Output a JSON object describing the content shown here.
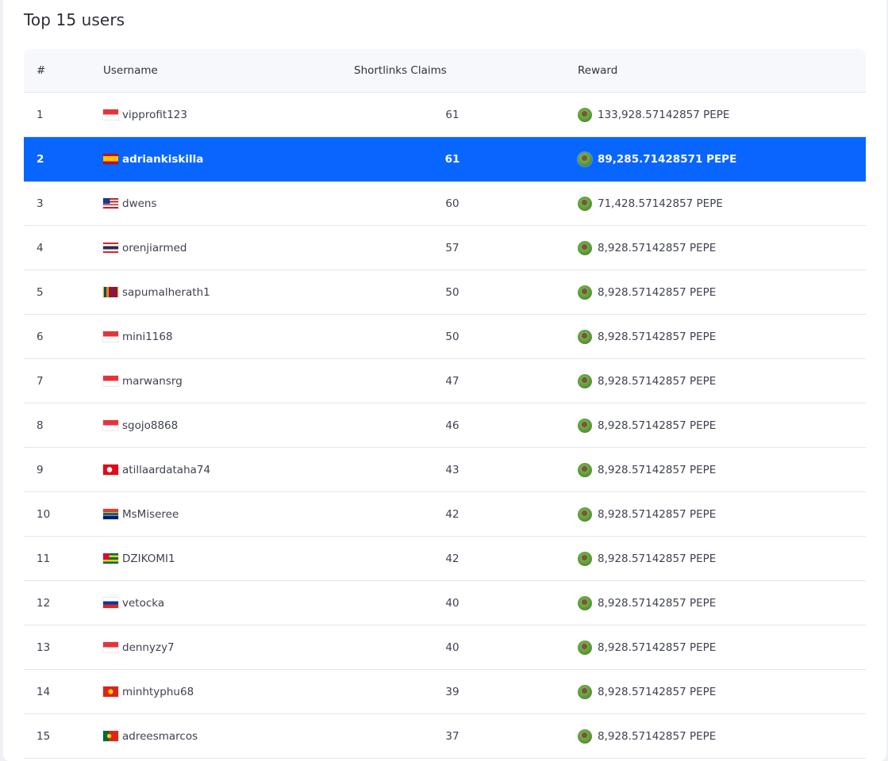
{
  "title": "Top 15 users",
  "table": {
    "headers": {
      "rank": "#",
      "username": "Username",
      "claims": "Shortlinks Claims",
      "reward": "Reward"
    },
    "highlighted_rank": "2",
    "rows": [
      {
        "rank": "1",
        "username": "vipprofit123",
        "flag": "indonesia",
        "claims": "61",
        "reward": "133,928.57142857 PEPE"
      },
      {
        "rank": "2",
        "username": "adriankiskilla",
        "flag": "spain",
        "claims": "61",
        "reward": "89,285.71428571 PEPE"
      },
      {
        "rank": "3",
        "username": "dwens",
        "flag": "malaysia",
        "claims": "60",
        "reward": "71,428.57142857 PEPE"
      },
      {
        "rank": "4",
        "username": "orenjiarmed",
        "flag": "thailand",
        "claims": "57",
        "reward": "8,928.57142857 PEPE"
      },
      {
        "rank": "5",
        "username": "sapumalherath1",
        "flag": "sri-lanka",
        "claims": "50",
        "reward": "8,928.57142857 PEPE"
      },
      {
        "rank": "6",
        "username": "mini1168",
        "flag": "indonesia",
        "claims": "50",
        "reward": "8,928.57142857 PEPE"
      },
      {
        "rank": "7",
        "username": "marwansrg",
        "flag": "indonesia",
        "claims": "47",
        "reward": "8,928.57142857 PEPE"
      },
      {
        "rank": "8",
        "username": "sgojo8868",
        "flag": "indonesia",
        "claims": "46",
        "reward": "8,928.57142857 PEPE"
      },
      {
        "rank": "9",
        "username": "atillaardataha74",
        "flag": "turkey",
        "claims": "43",
        "reward": "8,928.57142857 PEPE"
      },
      {
        "rank": "10",
        "username": "MsMiseree",
        "flag": "south-africa",
        "claims": "42",
        "reward": "8,928.57142857 PEPE"
      },
      {
        "rank": "11",
        "username": "DZIKOMI1",
        "flag": "togo",
        "claims": "42",
        "reward": "8,928.57142857 PEPE"
      },
      {
        "rank": "12",
        "username": "vetocka",
        "flag": "russia",
        "claims": "40",
        "reward": "8,928.57142857 PEPE"
      },
      {
        "rank": "13",
        "username": "dennyzy7",
        "flag": "indonesia",
        "claims": "40",
        "reward": "8,928.57142857 PEPE"
      },
      {
        "rank": "14",
        "username": "minhtyphu68",
        "flag": "vietnam",
        "claims": "39",
        "reward": "8,928.57142857 PEPE"
      },
      {
        "rank": "15",
        "username": "adreesmarcos",
        "flag": "portugal",
        "claims": "37",
        "reward": "8,928.57142857 PEPE"
      }
    ]
  },
  "colors": {
    "highlight": "#0866ff",
    "header_bg": "#f6f8fb",
    "border": "#e3e6ec"
  },
  "icons": {
    "reward": "pepe-coin-icon"
  }
}
